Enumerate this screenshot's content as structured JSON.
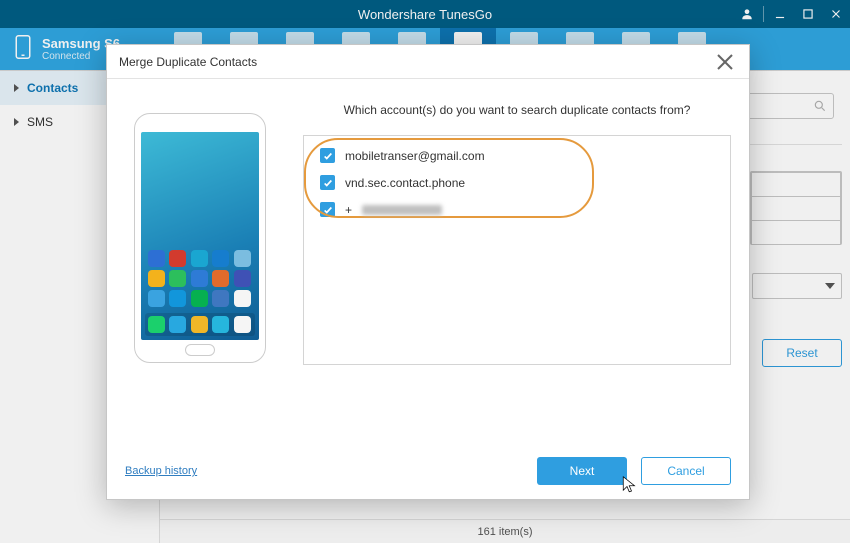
{
  "app": {
    "title": "Wondershare TunesGo"
  },
  "window_controls": {
    "user": "user-icon",
    "minimize": "minimize-icon",
    "maximize": "maximize-icon",
    "close": "close-icon"
  },
  "device": {
    "name": "Samsung S6",
    "status": "Connected"
  },
  "sidebar": {
    "items": [
      {
        "label": "Contacts",
        "active": true
      },
      {
        "label": "SMS",
        "active": false
      }
    ]
  },
  "content": {
    "search_placeholder": "",
    "reset_label": "Reset",
    "status_text": "161 item(s)"
  },
  "modal": {
    "title": "Merge Duplicate Contacts",
    "prompt": "Which account(s) do you want to search duplicate contacts from?",
    "accounts": [
      {
        "label": "mobiletranser@gmail.com",
        "checked": true,
        "obscured": false
      },
      {
        "label": "vnd.sec.contact.phone",
        "checked": true,
        "obscured": false
      },
      {
        "label": "+",
        "checked": true,
        "obscured": true
      }
    ],
    "backup_link": "Backup history",
    "next_label": "Next",
    "cancel_label": "Cancel"
  },
  "phone_apps_colors": [
    "#2d6fd4",
    "#d23b2e",
    "#1aa6d1",
    "#167dce",
    "#7bbde0",
    "#f3b21c",
    "#2cbf5c",
    "#2e7bd6",
    "#e06b2c",
    "#3f51b5",
    "#3aa3e0",
    "#1296db",
    "#06b050",
    "#3f77c0",
    "#f5f5f5"
  ],
  "dock_colors": [
    "#1bd06c",
    "#28a8e0",
    "#f0b728",
    "#26b6dd",
    "#f5f5f5"
  ],
  "colors": {
    "accent": "#2f9ee0",
    "titlebar": "#005f86",
    "ribbon": "#30a7e3",
    "halo": "#e59a3d"
  }
}
